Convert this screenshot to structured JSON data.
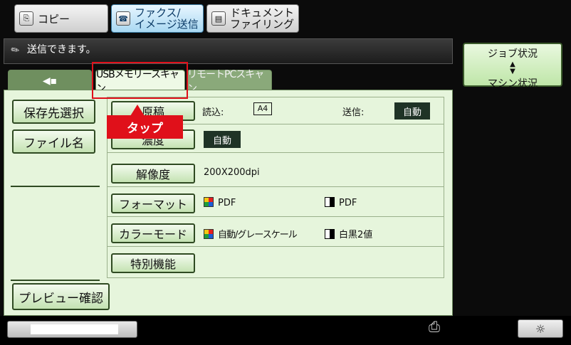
{
  "mode_tabs": [
    {
      "label": "コピー",
      "icon": "copy-icon"
    },
    {
      "label_line1": "ファクス/",
      "label_line2": "イメージ送信",
      "icon": "fax-icon",
      "active": true
    },
    {
      "label_line1": "ドキュメント",
      "label_line2": "ファイリング",
      "icon": "filing-icon"
    }
  ],
  "message": "送信できます。",
  "job_status": {
    "line1": "ジョブ状況",
    "line2": "マシン状況"
  },
  "subtabs": {
    "back_icon": "back-arrow-icon",
    "usb": "USBメモリースキャン",
    "pc": "リモートPCスキャン"
  },
  "left_buttons": {
    "destination": "保存先選択",
    "filename": "ファイル名",
    "preview": "プレビュー確認"
  },
  "rows": {
    "original": {
      "button": "原稿",
      "read_label": "読込:",
      "read_value": "A4",
      "send_label": "送信:",
      "send_value": "自動"
    },
    "density": {
      "button": "濃度",
      "value": "自動"
    },
    "resolution": {
      "button": "解像度",
      "value": "200X200dpi"
    },
    "format": {
      "button": "フォーマット",
      "color_value": "PDF",
      "mono_value": "PDF"
    },
    "color_mode": {
      "button": "カラーモード",
      "color_value": "自動/グレースケール",
      "mono_value": "白黒2値"
    },
    "special": {
      "button": "特別機能"
    }
  },
  "tap_label": "タップ",
  "progress_fraction": 0.77,
  "icons": {
    "memory": "usb-memory-icon",
    "brightness": "brightness-icon"
  }
}
